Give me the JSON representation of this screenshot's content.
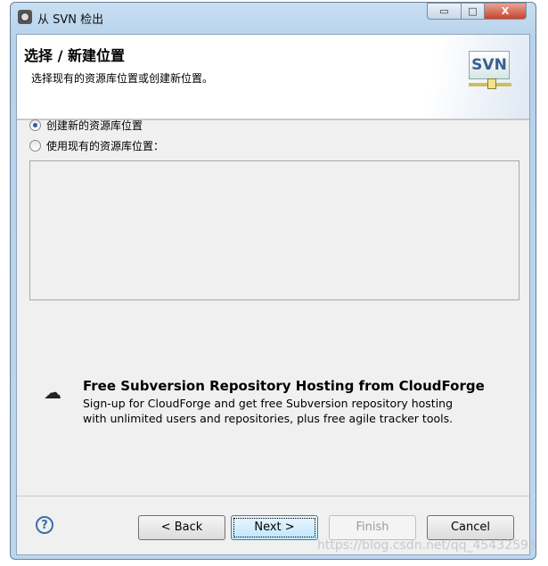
{
  "window": {
    "title": "从 SVN 检出",
    "minimize": "▭",
    "maximize": "□",
    "close": "X"
  },
  "header": {
    "title": "选择 / 新建位置",
    "description": "选择现有的资源库位置或创建新位置。",
    "logo_text": "SVN"
  },
  "options": [
    {
      "label": "创建新的资源库位置",
      "selected": true
    },
    {
      "label": "使用现有的资源库位置：",
      "selected": false
    }
  ],
  "promo": {
    "icon": "cloud-icon",
    "title": "Free Subversion Repository Hosting from CloudForge",
    "line1": "Sign-up for CloudForge and get free Subversion repository hosting",
    "line2": "with unlimited users and repositories, plus free agile tracker tools."
  },
  "buttons": {
    "help": "?",
    "back": "< Back",
    "next": "Next >",
    "finish": "Finish",
    "cancel": "Cancel"
  },
  "watermark": "https://blog.csdn.net/qq_45432593"
}
